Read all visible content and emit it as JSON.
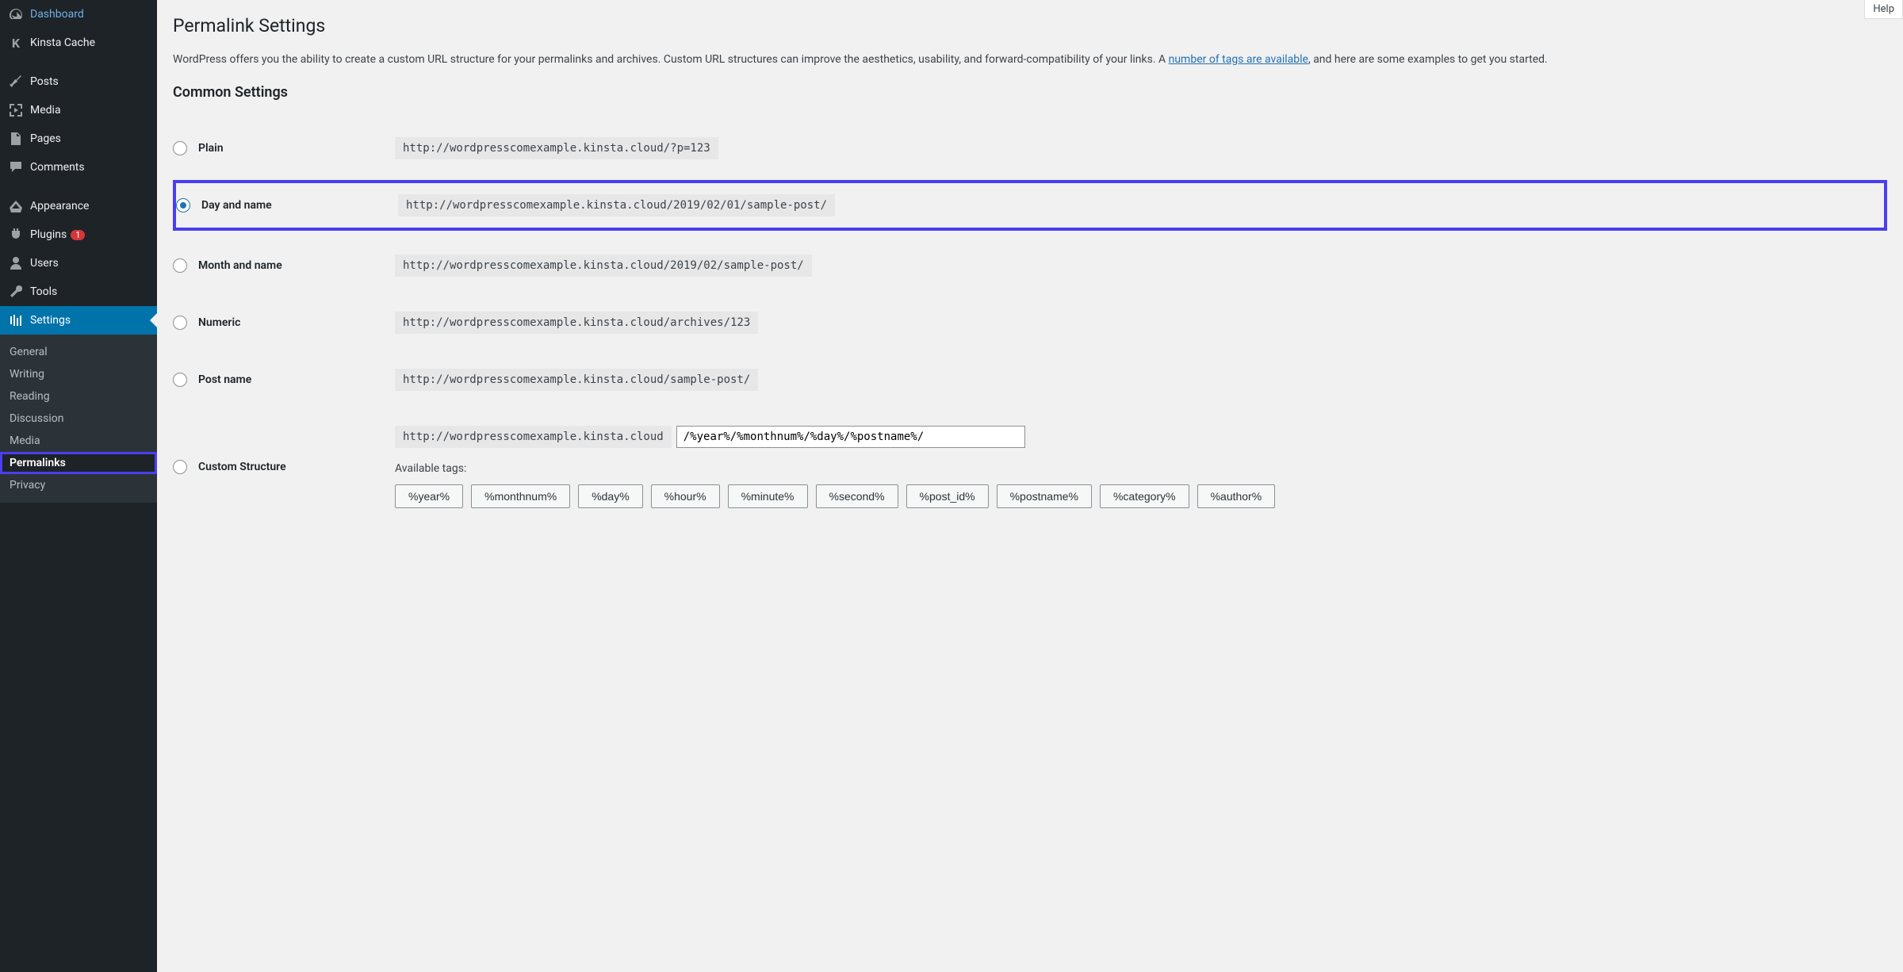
{
  "help": "Help",
  "sidebar": {
    "items": [
      {
        "label": "Dashboard"
      },
      {
        "label": "Kinsta Cache"
      },
      {
        "label": "Posts"
      },
      {
        "label": "Media"
      },
      {
        "label": "Pages"
      },
      {
        "label": "Comments"
      },
      {
        "label": "Appearance"
      },
      {
        "label": "Plugins",
        "badge": "1"
      },
      {
        "label": "Users"
      },
      {
        "label": "Tools"
      },
      {
        "label": "Settings"
      }
    ],
    "submenu": [
      {
        "label": "General"
      },
      {
        "label": "Writing"
      },
      {
        "label": "Reading"
      },
      {
        "label": "Discussion"
      },
      {
        "label": "Media"
      },
      {
        "label": "Permalinks"
      },
      {
        "label": "Privacy"
      }
    ]
  },
  "page": {
    "title": "Permalink Settings",
    "description_pre": "WordPress offers you the ability to create a custom URL structure for your permalinks and archives. Custom URL structures can improve the aesthetics, usability, and forward-compatibility of your links. A ",
    "description_link": "number of tags are available",
    "description_post": ", and here are some examples to get you started.",
    "section_title": "Common Settings"
  },
  "options": [
    {
      "label": "Plain",
      "example": "http://wordpresscomexample.kinsta.cloud/?p=123"
    },
    {
      "label": "Day and name",
      "example": "http://wordpresscomexample.kinsta.cloud/2019/02/01/sample-post/"
    },
    {
      "label": "Month and name",
      "example": "http://wordpresscomexample.kinsta.cloud/2019/02/sample-post/"
    },
    {
      "label": "Numeric",
      "example": "http://wordpresscomexample.kinsta.cloud/archives/123"
    },
    {
      "label": "Post name",
      "example": "http://wordpresscomexample.kinsta.cloud/sample-post/"
    }
  ],
  "custom": {
    "label": "Custom Structure",
    "prefix": "http://wordpresscomexample.kinsta.cloud",
    "value": "/%year%/%monthnum%/%day%/%postname%/",
    "tags_label": "Available tags:",
    "tags": [
      "%year%",
      "%monthnum%",
      "%day%",
      "%hour%",
      "%minute%",
      "%second%",
      "%post_id%",
      "%postname%",
      "%category%",
      "%author%"
    ]
  }
}
